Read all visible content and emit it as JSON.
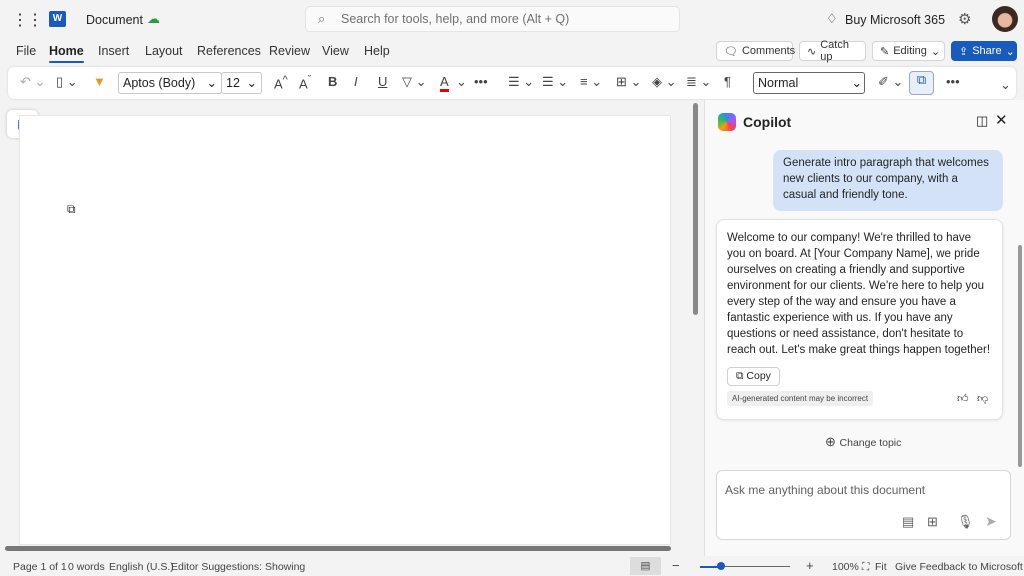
{
  "titlebar": {
    "app_icon": "word-icon",
    "doc_title": "Document",
    "sync_icon": "cloud-check-icon",
    "search_placeholder": "Search for tools, help, and more (Alt + Q)",
    "buy": "Buy Microsoft 365"
  },
  "tabs": [
    {
      "label": "File"
    },
    {
      "label": "Home"
    },
    {
      "label": "Insert"
    },
    {
      "label": "Layout"
    },
    {
      "label": "References"
    },
    {
      "label": "Review"
    },
    {
      "label": "View"
    },
    {
      "label": "Help"
    }
  ],
  "actions": {
    "comments": "Comments",
    "catchup": "Catch up",
    "editing": "Editing",
    "share": "Share"
  },
  "ribbon": {
    "font": "Aptos (Body)",
    "size": "12",
    "style": "Normal"
  },
  "copilot": {
    "title": "Copilot",
    "prompt": "Generate intro paragraph that welcomes new clients to our company, with a casual and friendly tone.",
    "response": "Welcome to our company! We're thrilled to have you on board. At [Your Company Name], we pride ourselves on creating a friendly and supportive environment for our clients. We're here to help you every step of the way and ensure you have a fantastic experience with us. If you have any questions or need assistance, don't hesitate to reach out. Let's make great things happen together!",
    "copy": "Copy",
    "disclaimer": "AI-generated content may be incorrect",
    "change_topic": "Change topic",
    "input_placeholder": "Ask me anything about this document"
  },
  "status": {
    "page": "Page 1 of 1",
    "words": "0 words",
    "language": "English (U.S.)",
    "editor": "Editor Suggestions: Showing",
    "zoom": "100%",
    "fit": "Fit",
    "feedback": "Give Feedback to Microsoft",
    "zoom_level_percent": 100
  },
  "colors": {
    "accent": "#185abd",
    "bubble": "#d4e2f7"
  }
}
